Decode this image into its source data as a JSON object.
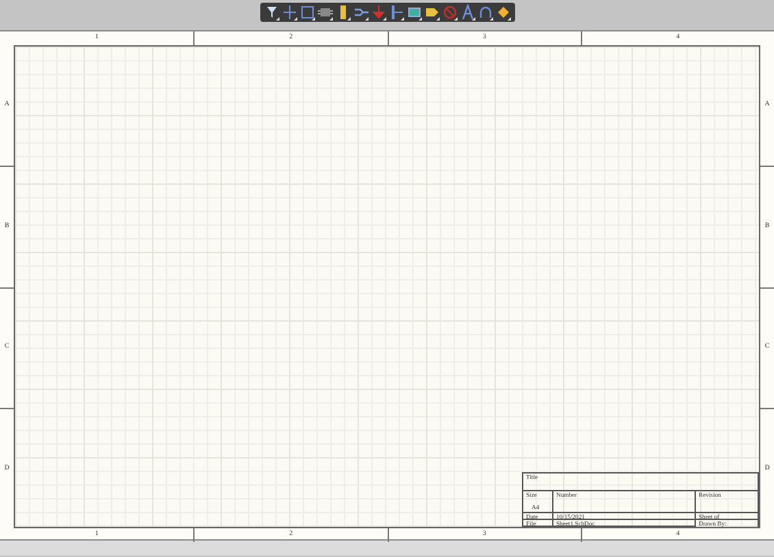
{
  "toolbar": {
    "tools": [
      {
        "kind": "filter"
      },
      {
        "kind": "cross"
      },
      {
        "kind": "rect"
      },
      {
        "kind": "part"
      },
      {
        "kind": "bar"
      },
      {
        "kind": "bus"
      },
      {
        "kind": "power"
      },
      {
        "kind": "port"
      },
      {
        "kind": "sheet"
      },
      {
        "kind": "tag"
      },
      {
        "kind": "nope"
      },
      {
        "kind": "text"
      },
      {
        "kind": "arc"
      },
      {
        "kind": "diamond"
      }
    ]
  },
  "sheet": {
    "top_columns": [
      "1",
      "2",
      "3",
      "4"
    ],
    "left_rows": [
      "A",
      "B",
      "C",
      "D"
    ],
    "right_rows": [
      "A",
      "B",
      "C",
      "D"
    ],
    "bottom_columns": [
      "1",
      "2",
      "3",
      "4"
    ],
    "title_block": {
      "title_label": "Title",
      "size_label": "Size",
      "size": "A4",
      "number_label": "Number",
      "revision_label": "Revision",
      "date_label": "Date",
      "date": "10/15/2021",
      "sheet_label": "Sheet  of",
      "file_label": "File",
      "file": "Sheet1.SchDoc",
      "drawn_label": "Drawn By:"
    }
  }
}
